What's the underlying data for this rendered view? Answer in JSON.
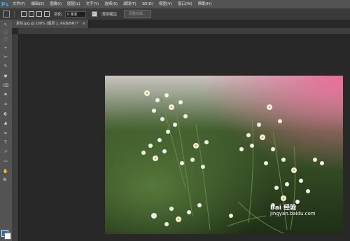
{
  "menu": {
    "logo": "Ps",
    "items": [
      "文件(F)",
      "编辑(E)",
      "图像(I)",
      "图层(L)",
      "文字(Y)",
      "选择(S)",
      "滤镜(T)",
      "3D(D)",
      "视图(V)",
      "窗口(W)",
      "帮助(H)"
    ]
  },
  "options": {
    "feather_label": "羽化:",
    "feather_value": "0 像素",
    "antialias_label": "消除锯齿",
    "refine_label": "调整边缘..."
  },
  "tab": {
    "title": "素材.jpg @ 100% (图层 1, RGB/8#) *",
    "close": "×"
  },
  "tools": [
    "↖",
    "⬚",
    "◌",
    "⌖",
    "✂",
    "✎",
    "♥",
    "⌫",
    "⚑",
    "⌂",
    "◐",
    "▲",
    "✒",
    "T",
    "↗",
    "▭",
    "✋",
    "🔍"
  ],
  "watermark": {
    "main": "Bai 经验",
    "sub": "jingyan.baidu.com"
  },
  "colors": {
    "foreground": "#1d6fe0",
    "background": "#ffffff"
  }
}
